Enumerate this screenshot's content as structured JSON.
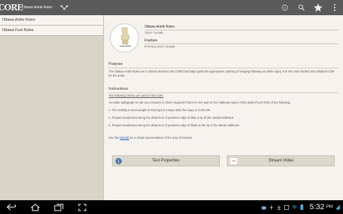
{
  "app": {
    "logo_text": "CORE",
    "title": "Ottawa Ankle Rules"
  },
  "sidebar": {
    "items": [
      {
        "label": "Ottawa Ankle Rules"
      },
      {
        "label": "Ottawa Foot Rules"
      }
    ]
  },
  "header": {
    "badge_caption": "Fresh Ankle",
    "test_name_value": "Ottawa Ankle Rules",
    "test_name_label": "TEST NAME",
    "pathology_value": "Fracture",
    "pathology_label": "PATHOLOGY NAME"
  },
  "purpose": {
    "title": "Purpose",
    "text": "The Ottawa Ankle Rules are a clinical decision rule (CDR) that helps guide the appropriate ordering of imaging following an ankle injury.  It is the most studied and validated CDR for the ankle."
  },
  "instructions": {
    "title": "Instructions",
    "criteria_heading": "The following criteria are used in this CDR:",
    "intro": "An ankle radiograph to rule out a fracture is ONLY required if there is ANY pain in the malleolar region of the ankle PLUS ONE of the following:",
    "items": [
      "1. The inability to bear weight on that leg for 4 steps after the injury or in the ER.",
      "2. Pinpoint tenderness along the distal 6cm of posterior edge of tibia or tip of the medial malleolus",
      "3. Pinpoint tenderness along the distal 6cm of posterior edge of fibula or the tip of the lateral malleolus"
    ],
    "see_prefix": "See this ",
    "see_link": "IMAGE",
    "see_suffix": " for a visual representation of the area of interest."
  },
  "buttons": {
    "test_properties": "Test Properties",
    "stream_video": "Stream Video",
    "youtube_text": "You"
  },
  "system": {
    "time": "5:32",
    "ampm": "PM"
  },
  "colors": {
    "action_bar": "#5a5a5a",
    "sidebar_bg": "#d9d4c8",
    "content_bg": "#f5f3ee",
    "link": "#1a4fb5",
    "youtube_red": "#d62b1f",
    "info_blue": "#4a6fa8"
  },
  "icons": {
    "share": "share-nodes-icon",
    "info": "info-icon",
    "search": "search-icon",
    "favorite": "star-icon",
    "overflow": "overflow-menu-icon",
    "back": "back-icon",
    "home": "home-icon",
    "recents": "recent-apps-icon",
    "screenshot": "screenshot-icon",
    "wifi": "wifi-icon",
    "battery": "battery-icon"
  }
}
